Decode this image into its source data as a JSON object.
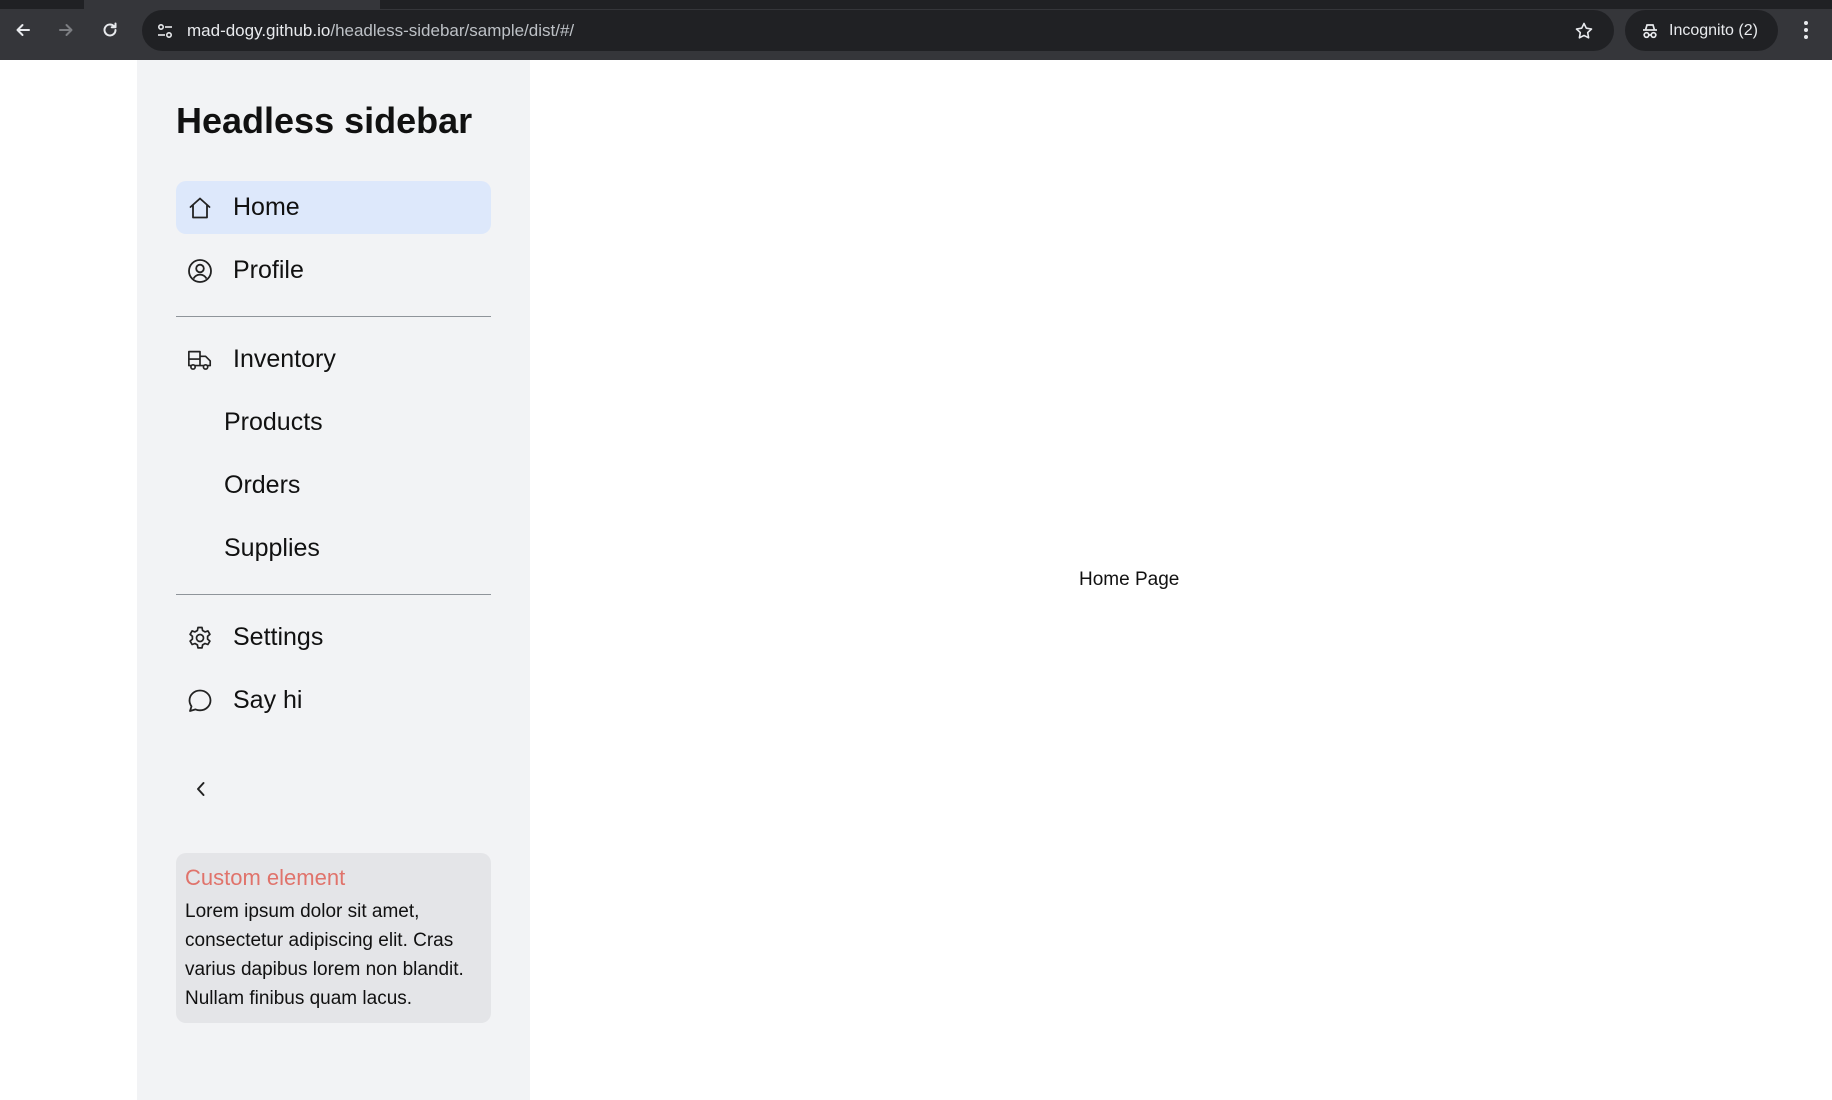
{
  "browser": {
    "url_host": "mad-dogy.github.io",
    "url_path": "/headless-sidebar/sample/dist/#/",
    "incognito_label": "Incognito (2)"
  },
  "sidebar": {
    "title": "Headless sidebar",
    "items": [
      {
        "label": "Home",
        "icon": "home-icon",
        "active": true
      },
      {
        "label": "Profile",
        "icon": "user-circle-icon",
        "active": false
      },
      {
        "label": "Inventory",
        "icon": "truck-icon",
        "active": false
      },
      {
        "label": "Settings",
        "icon": "gear-icon",
        "active": false
      },
      {
        "label": "Say hi",
        "icon": "chat-bubble-icon",
        "active": false
      }
    ],
    "subitems": [
      "Products",
      "Orders",
      "Supplies"
    ],
    "collapse_icon": "chevron-left-icon",
    "card": {
      "title": "Custom element",
      "body": "Lorem ipsum dolor sit amet, consectetur adipiscing elit. Cras varius dapibus lorem non blandit. Nullam finibus quam lacus."
    }
  },
  "main": {
    "text": "Home Page"
  },
  "colors": {
    "active_bg": "#dde8fb",
    "sidebar_bg": "#f2f3f5",
    "card_bg": "#e4e5e8",
    "card_title": "#e0736b"
  }
}
